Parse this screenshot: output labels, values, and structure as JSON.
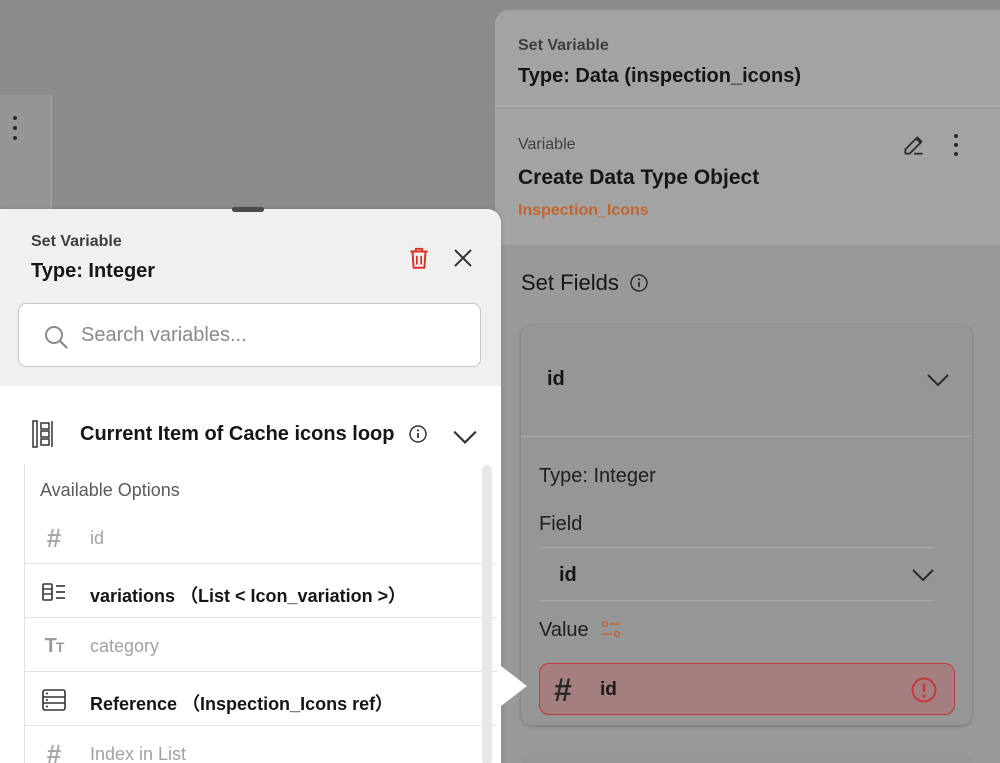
{
  "right_panel": {
    "header": {
      "subtitle": "Set Variable",
      "title": "Type: Data (inspection_icons)"
    },
    "variable": {
      "label": "Variable",
      "name": "Create Data Type Object",
      "type_name": "Inspection_Icons",
      "edit_icon": "pencil-icon",
      "more_icon": "more-vert-icon"
    },
    "set_fields": {
      "title": "Set Fields",
      "info_icon": "info-icon"
    },
    "field_card": {
      "field_name": "id",
      "type_label": "Type: Integer",
      "field_label": "Field",
      "field_value": "id",
      "value_label": "Value",
      "value_text": "id",
      "value_icon": "hash-icon",
      "error_icon": "error-icon",
      "error_color": "#c23a3a"
    }
  },
  "popup": {
    "header": {
      "subtitle": "Set Variable",
      "title": "Type: Integer"
    },
    "search": {
      "placeholder": "Search variables...",
      "value": ""
    },
    "group": {
      "label": "Current Item of Cache icons loop",
      "icon": "data-structure-icon"
    },
    "options": {
      "title": "Available Options",
      "items": [
        {
          "label": "id",
          "icon": "hash-icon",
          "enabled": false
        },
        {
          "label": "variations （List < Icon_variation >）",
          "icon": "list-icon",
          "enabled": true
        },
        {
          "label": "category",
          "icon": "text-type-icon",
          "enabled": false
        },
        {
          "label": "Reference （Inspection_Icons ref）",
          "icon": "database-ref-icon",
          "enabled": true
        },
        {
          "label": "Index in List",
          "icon": "hash-icon",
          "enabled": false
        }
      ]
    }
  },
  "colors": {
    "accent_orange": "#c4652e",
    "error_red": "#c23a3a",
    "trash_red": "#d93025"
  }
}
